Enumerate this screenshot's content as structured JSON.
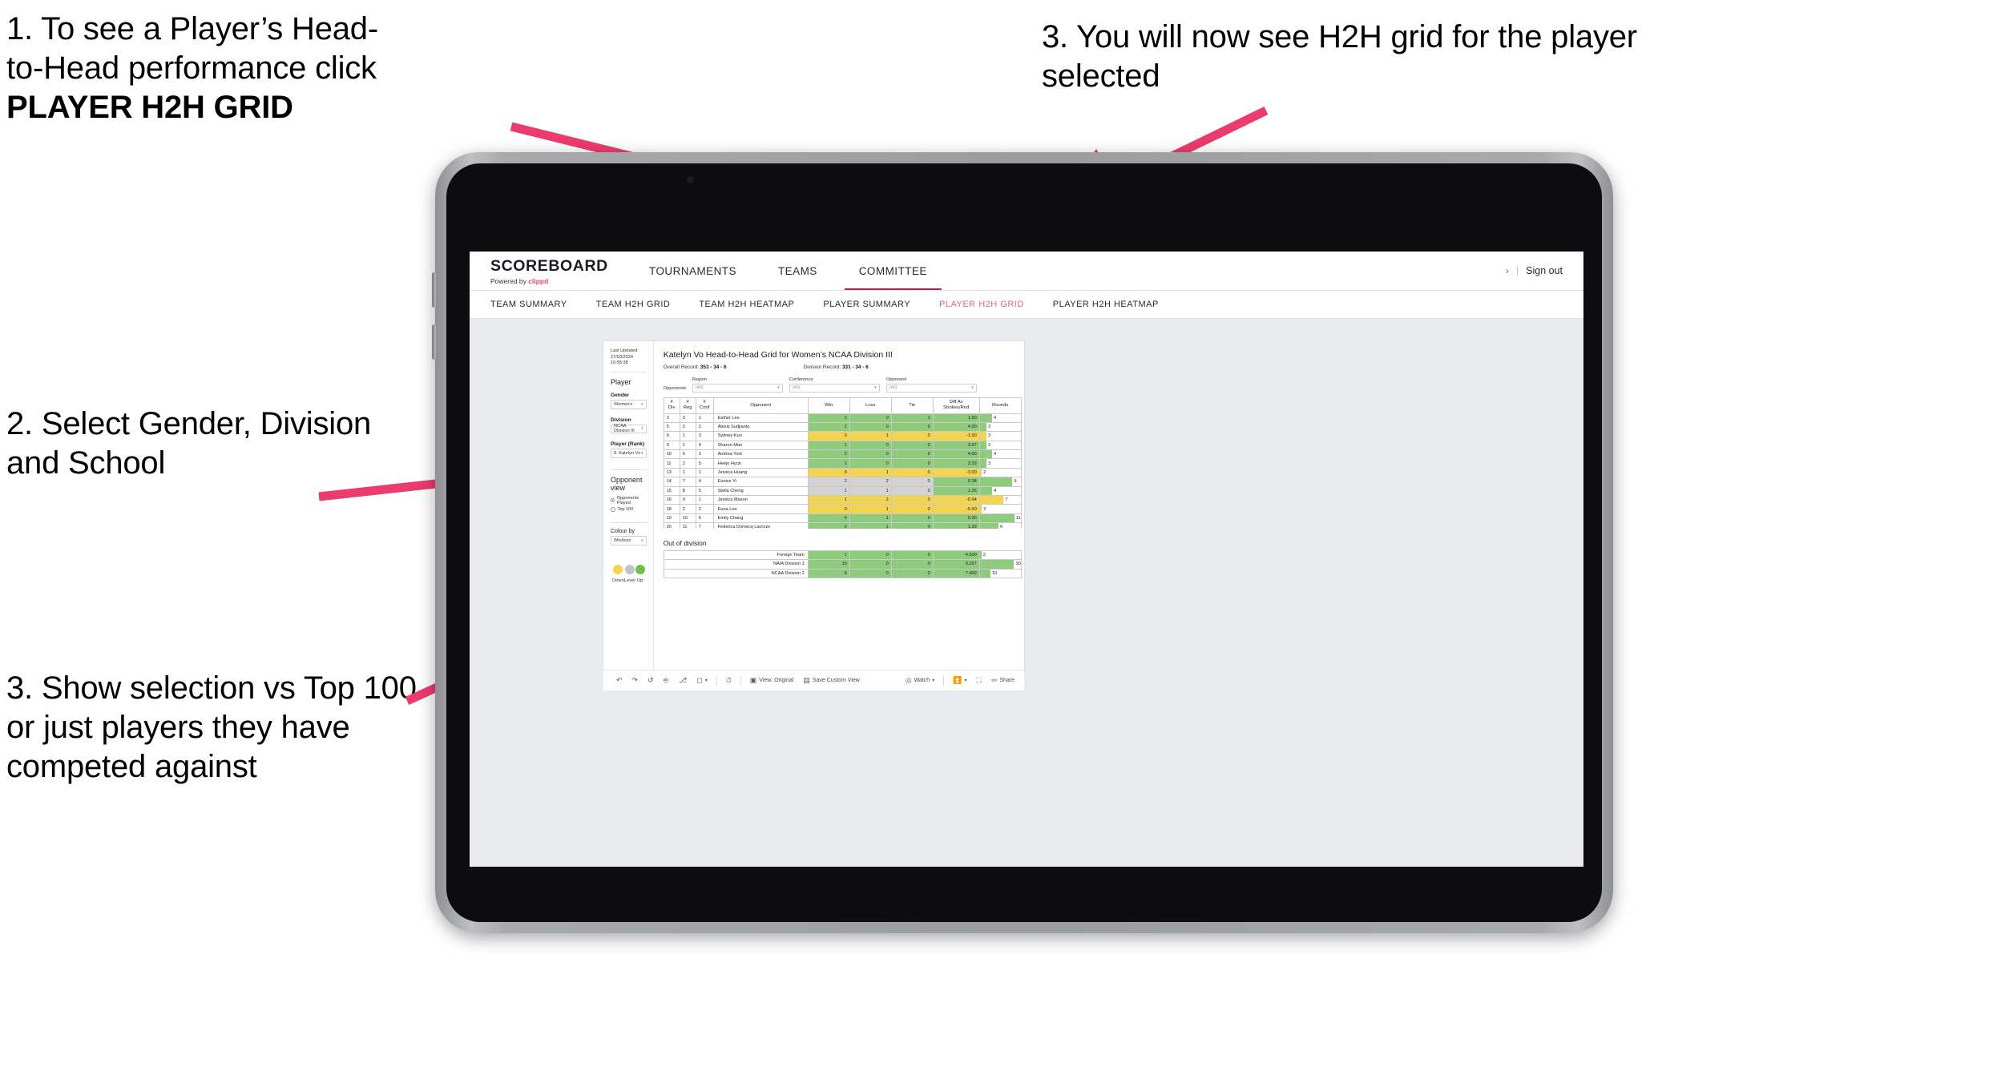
{
  "annotations": [
    {
      "id": "a1",
      "line1": "1. To see a Player’s Head-",
      "line2": "to-Head performance click",
      "line3": "PLAYER H2H GRID"
    },
    {
      "id": "a2",
      "text": "2. Select Gender, Division and School"
    },
    {
      "id": "a3",
      "text": "3. Show selection vs Top 100 or just players they have competed against"
    },
    {
      "id": "a4",
      "text": "3. You will now see H2H grid for the player selected"
    }
  ],
  "brand": {
    "name": "SCOREBOARD",
    "powered_prefix": "Powered by ",
    "powered_brand": "clippd"
  },
  "topnav": {
    "items": [
      {
        "label": "TOURNAMENTS",
        "active": false
      },
      {
        "label": "TEAMS",
        "active": false
      },
      {
        "label": "COMMITTEE",
        "active": true
      }
    ],
    "chevron": "›",
    "divider": "|",
    "sign_out": "Sign out"
  },
  "subnav": {
    "items": [
      {
        "label": "TEAM SUMMARY",
        "active": false
      },
      {
        "label": "TEAM H2H GRID",
        "active": false
      },
      {
        "label": "TEAM H2H HEATMAP",
        "active": false
      },
      {
        "label": "PLAYER SUMMARY",
        "active": false
      },
      {
        "label": "PLAYER H2H GRID",
        "active": true
      },
      {
        "label": "PLAYER H2H HEATMAP",
        "active": false
      }
    ]
  },
  "sidebar": {
    "last_updated_line1": "Last Updated: 27/03/2024",
    "last_updated_line2": "16:55:38",
    "player_heading": "Player",
    "filters": [
      {
        "label": "Gender",
        "value": "Women's"
      },
      {
        "label": "Division",
        "value": "NCAA Division III"
      },
      {
        "label": "Player (Rank)",
        "value": "8. Katelyn Vo"
      }
    ],
    "opponent_view_heading": "Opponent view",
    "radios": [
      {
        "label": "Opponents Played",
        "selected": true
      },
      {
        "label": "Top 100",
        "selected": false
      }
    ],
    "colour_by_label": "Colour by",
    "colour_by_value": "Win/loss",
    "legend": [
      {
        "label": "Down",
        "color": "#f2d450"
      },
      {
        "label": "Level",
        "color": "#c4c4c4"
      },
      {
        "label": "Up",
        "color": "#6fbf4a"
      }
    ]
  },
  "main": {
    "title": "Katelyn Vo Head-to-Head Grid for Women’s NCAA Division III",
    "overall_record_label": "Overall Record: ",
    "overall_record_value": "353 - 34 - 6",
    "division_record_label": "Division Record: ",
    "division_record_value": "331 - 34 - 6",
    "opponents_label": "Opponents:",
    "opponent_filters": [
      {
        "label": "Region",
        "value": "(All)"
      },
      {
        "label": "Conference",
        "value": "(All)"
      },
      {
        "label": "Opponent",
        "value": "(All)"
      }
    ],
    "columns": [
      "#\nDiv",
      "#\nReg",
      "#\nConf",
      "Opponent",
      "Win",
      "Loss",
      "Tie",
      "Diff Av\nStrokes/Rnd",
      "Rounds"
    ],
    "column_labels": [
      {
        "l1": "#",
        "l2": "Div"
      },
      {
        "l1": "#",
        "l2": "Reg"
      },
      {
        "l1": "#",
        "l2": "Conf"
      },
      {
        "l1": "Opponent",
        "l2": ""
      },
      {
        "l1": "Win",
        "l2": ""
      },
      {
        "l1": "Loss",
        "l2": ""
      },
      {
        "l1": "Tie",
        "l2": ""
      },
      {
        "l1": "Diff Av",
        "l2": "Strokes/Rnd"
      },
      {
        "l1": "Rounds",
        "l2": ""
      }
    ],
    "rows": [
      {
        "div": "3",
        "reg": "3",
        "conf": "1",
        "opponent": "Esther Lee",
        "win": "1",
        "loss": "0",
        "tie": "1",
        "diff": "1.50",
        "rounds": "4",
        "state": "up",
        "bar_pct": 30
      },
      {
        "div": "5",
        "reg": "2",
        "conf": "2",
        "opponent": "Alexis Sudjianto",
        "win": "1",
        "loss": "0",
        "tie": "0",
        "diff": "4.00",
        "rounds": "3",
        "state": "up",
        "bar_pct": 16
      },
      {
        "div": "6",
        "reg": "1",
        "conf": "3",
        "opponent": "Sydney Kuo",
        "win": "0",
        "loss": "1",
        "tie": "0",
        "diff": "-1.00",
        "rounds": "3",
        "state": "down",
        "bar_pct": 16
      },
      {
        "div": "9",
        "reg": "1",
        "conf": "4",
        "opponent": "Sharon Mun",
        "win": "1",
        "loss": "0",
        "tie": "0",
        "diff": "3.67",
        "rounds": "3",
        "state": "up",
        "bar_pct": 16
      },
      {
        "div": "10",
        "reg": "6",
        "conf": "3",
        "opponent": "Andrea York",
        "win": "2",
        "loss": "0",
        "tie": "0",
        "diff": "4.00",
        "rounds": "4",
        "state": "up",
        "bar_pct": 30
      },
      {
        "div": "11",
        "reg": "2",
        "conf": "5",
        "opponent": "Heejo Hyun",
        "win": "1",
        "loss": "0",
        "tie": "0",
        "diff": "3.33",
        "rounds": "3",
        "state": "up",
        "bar_pct": 16
      },
      {
        "div": "13",
        "reg": "1",
        "conf": "1",
        "opponent": "Jessica Huang",
        "win": "0",
        "loss": "1",
        "tie": "0",
        "diff": "-3.00",
        "rounds": "2",
        "state": "down",
        "bar_pct": 5
      },
      {
        "div": "14",
        "reg": "7",
        "conf": "4",
        "opponent": "Eunice Yi",
        "win": "2",
        "loss": "2",
        "tie": "0",
        "diff": "0.38",
        "rounds": "9",
        "state": "level",
        "diff_state": "up",
        "bar_pct": 80
      },
      {
        "div": "15",
        "reg": "8",
        "conf": "5",
        "opponent": "Stella Cheng",
        "win": "1",
        "loss": "1",
        "tie": "0",
        "diff": "1.25",
        "rounds": "4",
        "state": "level",
        "diff_state": "up",
        "bar_pct": 30
      },
      {
        "div": "16",
        "reg": "9",
        "conf": "1",
        "opponent": "Jessica Mason",
        "win": "1",
        "loss": "2",
        "tie": "0",
        "diff": "-0.94",
        "rounds": "7",
        "state": "down",
        "bar_pct": 58
      },
      {
        "div": "18",
        "reg": "2",
        "conf": "2",
        "opponent": "Euna Lee",
        "win": "0",
        "loss": "1",
        "tie": "0",
        "diff": "-5.00",
        "rounds": "2",
        "state": "down",
        "bar_pct": 5
      },
      {
        "div": "19",
        "reg": "10",
        "conf": "6",
        "opponent": "Emily Chang",
        "win": "4",
        "loss": "1",
        "tie": "0",
        "diff": "0.30",
        "rounds": "11",
        "state": "up",
        "bar_pct": 90
      },
      {
        "div": "20",
        "reg": "11",
        "conf": "7",
        "opponent": "Federica Domecq Lacroze",
        "win": "2",
        "loss": "1",
        "tie": "0",
        "diff": "1.33",
        "rounds": "6",
        "state": "up",
        "bar_pct": 46
      }
    ],
    "out_of_division_title": "Out of division",
    "out_of_division_rows": [
      {
        "name": "Foreign Team",
        "win": "1",
        "loss": "0",
        "tie": "0",
        "diff": "4.500",
        "rounds": "2",
        "state": "up",
        "bar_pct": 4
      },
      {
        "name": "NAIA Division 1",
        "win": "15",
        "loss": "0",
        "tie": "0",
        "diff": "9.267",
        "rounds": "30",
        "state": "up",
        "bar_pct": 86
      },
      {
        "name": "NCAA Division 2",
        "win": "5",
        "loss": "0",
        "tie": "0",
        "diff": "7.400",
        "rounds": "10",
        "state": "up",
        "bar_pct": 26
      }
    ]
  },
  "toolbar": {
    "items": [
      {
        "icon": "undo-icon",
        "label": ""
      },
      {
        "icon": "redo-icon",
        "label": ""
      },
      {
        "icon": "revert-icon",
        "label": ""
      },
      {
        "icon": "refresh-data-icon",
        "label": ""
      },
      {
        "icon": "pause-updates-icon",
        "label": ""
      },
      {
        "icon": "alert-icon",
        "label": ""
      },
      {
        "icon": "view-original-icon",
        "label": "View: Original"
      },
      {
        "icon": "save-custom-view-icon",
        "label": "Save Custom View"
      },
      {
        "icon": "watch-icon",
        "label": "Watch"
      },
      {
        "icon": "download-icon",
        "label": ""
      },
      {
        "icon": "fullscreen-icon",
        "label": ""
      },
      {
        "icon": "share-icon",
        "label": "Share"
      }
    ]
  },
  "colors": {
    "accent_pink": "#e8456e",
    "tab_active": "#e8658a",
    "green": "#8fcb7c",
    "yellow": "#f2d450",
    "grey": "#d3d3d3",
    "arrow": "#ec3b6d"
  }
}
